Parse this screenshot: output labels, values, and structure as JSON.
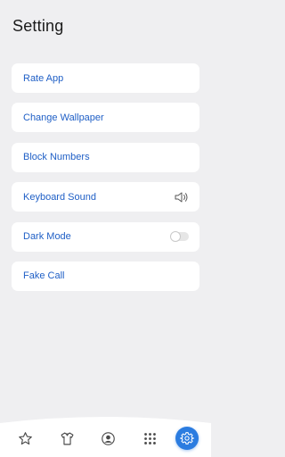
{
  "header": {
    "title": "Setting"
  },
  "settings": {
    "items": [
      {
        "label": "Rate App"
      },
      {
        "label": "Change Wallpaper"
      },
      {
        "label": "Block Numbers"
      },
      {
        "label": "Keyboard Sound",
        "icon": "speaker-icon"
      },
      {
        "label": "Dark Mode",
        "icon": "toggle",
        "enabled": false
      },
      {
        "label": "Fake Call"
      }
    ]
  },
  "bottom_nav": {
    "items": [
      {
        "icon": "star-icon"
      },
      {
        "icon": "shirt-icon"
      },
      {
        "icon": "profile-icon"
      },
      {
        "icon": "grid-icon"
      },
      {
        "icon": "gear-icon",
        "active": true
      }
    ]
  },
  "colors": {
    "background": "#efeff1",
    "card": "#ffffff",
    "label": "#1f5fc6",
    "accent": "#2b7ce0"
  }
}
